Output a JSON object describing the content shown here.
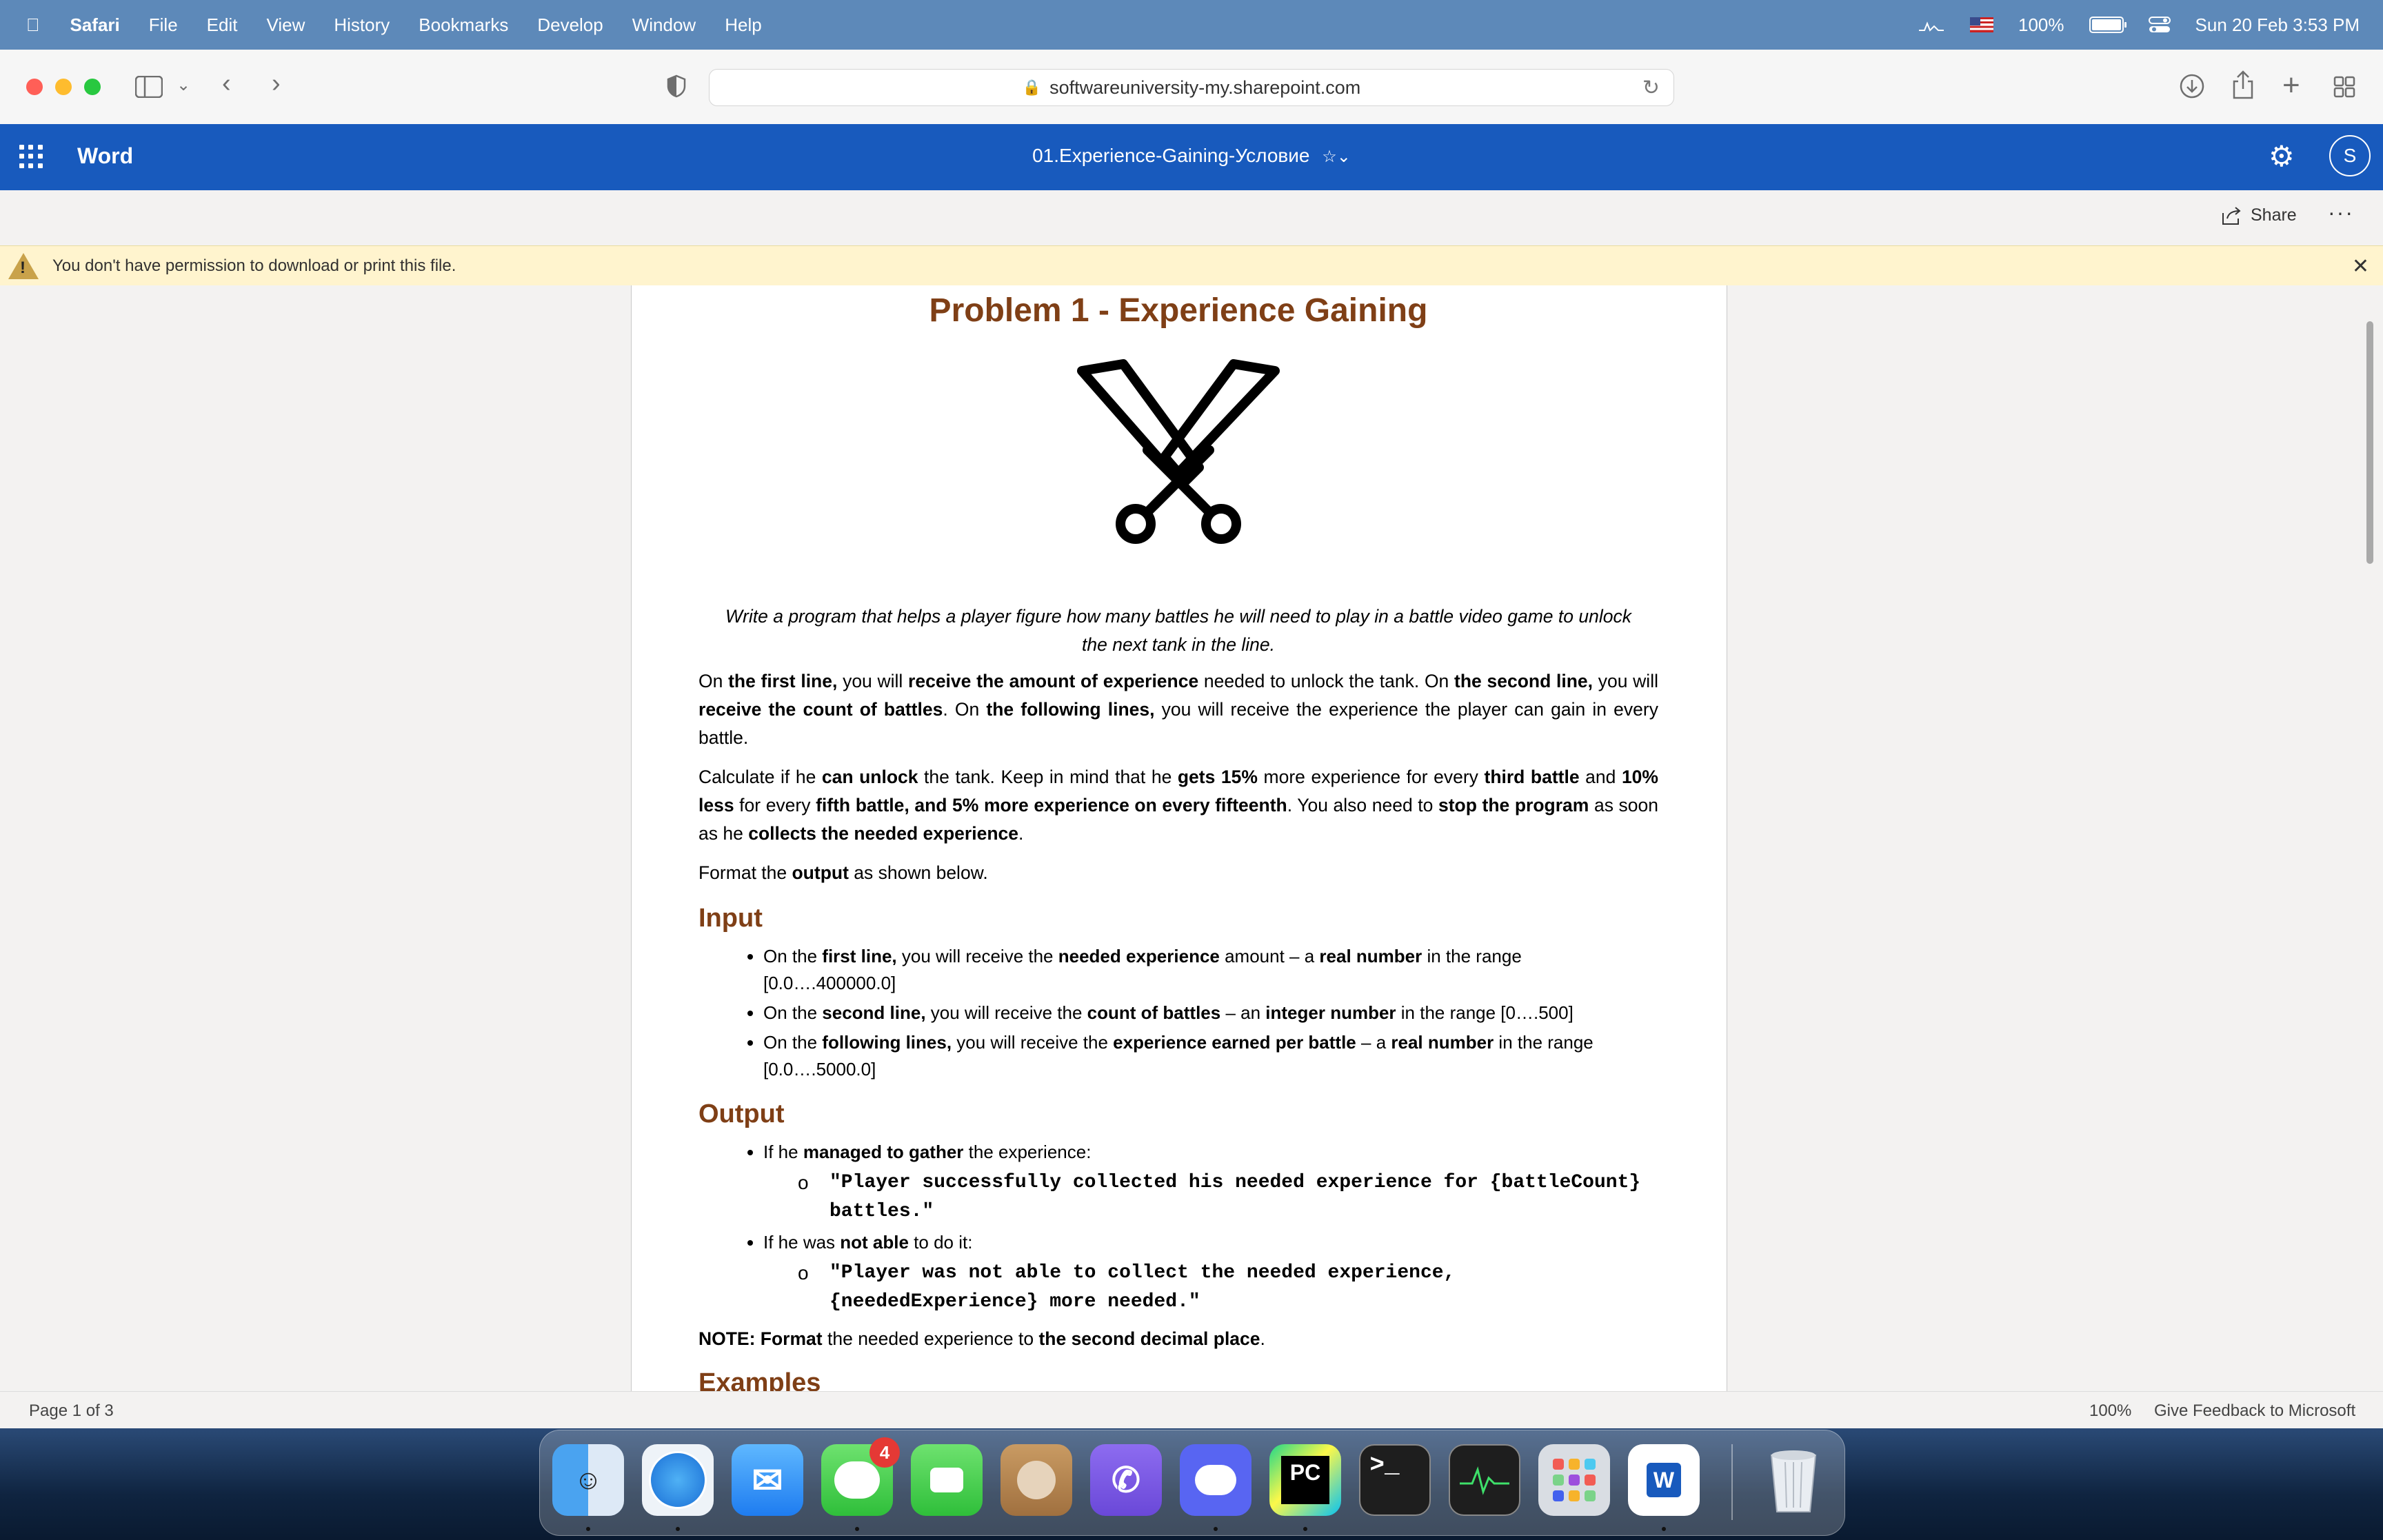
{
  "menubar": {
    "items": [
      "Safari",
      "File",
      "Edit",
      "View",
      "History",
      "Bookmarks",
      "Develop",
      "Window",
      "Help"
    ],
    "battery_label": "100%",
    "battery_level": 1.0,
    "datetime": "Sun 20 Feb  3:53 PM"
  },
  "browser": {
    "url": "softwareuniversity-my.sharepoint.com"
  },
  "word": {
    "app_name": "Word",
    "doc_title": "01.Experience-Gaining-Условие",
    "avatar_initial": "S",
    "share_label": "Share",
    "more_label": "···"
  },
  "notice": {
    "text": "You don't have permission to download or print this file."
  },
  "document": {
    "title": "Problem 1 - Experience Gaining",
    "lead": "Write a program that helps a player figure how many battles he will need to play in a battle video game to unlock the next tank in the line.",
    "p1": [
      {
        "t": "On ",
        "b": false
      },
      {
        "t": "the first line,",
        "b": true
      },
      {
        "t": " you will ",
        "b": false
      },
      {
        "t": "receive the amount of experience",
        "b": true
      },
      {
        "t": " needed to unlock the tank. On ",
        "b": false
      },
      {
        "t": "the second line,",
        "b": true
      },
      {
        "t": " you will ",
        "b": false
      },
      {
        "t": "receive the count of battles",
        "b": true
      },
      {
        "t": ". On ",
        "b": false
      },
      {
        "t": "the following lines,",
        "b": true
      },
      {
        "t": " you will receive the experience the player can gain in every battle.",
        "b": false
      }
    ],
    "p2": [
      {
        "t": "Calculate if he ",
        "b": false
      },
      {
        "t": "can unlock",
        "b": true
      },
      {
        "t": " the tank. Keep in mind that he ",
        "b": false
      },
      {
        "t": "gets 15%",
        "b": true
      },
      {
        "t": " more experience for every ",
        "b": false
      },
      {
        "t": "third battle",
        "b": true
      },
      {
        "t": " and ",
        "b": false
      },
      {
        "t": "10% less",
        "b": true
      },
      {
        "t": " for every ",
        "b": false
      },
      {
        "t": "fifth battle, and 5% more experience on every fifteenth",
        "b": true
      },
      {
        "t": ". You also need to ",
        "b": false
      },
      {
        "t": "stop the program",
        "b": true
      },
      {
        "t": " as soon as he ",
        "b": false
      },
      {
        "t": "collects the needed experience",
        "b": true
      },
      {
        "t": ".",
        "b": false
      }
    ],
    "p3": [
      {
        "t": "Format the ",
        "b": false
      },
      {
        "t": "output",
        "b": true
      },
      {
        "t": " as shown below.",
        "b": false
      }
    ],
    "input_heading": "Input",
    "input_items": [
      [
        {
          "t": "On the ",
          "b": false
        },
        {
          "t": "first line,",
          "b": true
        },
        {
          "t": " you will receive the ",
          "b": false
        },
        {
          "t": "needed experience",
          "b": true
        },
        {
          "t": " amount – a ",
          "b": false
        },
        {
          "t": "real number",
          "b": true
        },
        {
          "t": " in the range [0.0….400000.0]",
          "b": false
        }
      ],
      [
        {
          "t": "On the ",
          "b": false
        },
        {
          "t": "second line,",
          "b": true
        },
        {
          "t": " you will receive the ",
          "b": false
        },
        {
          "t": "count of battles",
          "b": true
        },
        {
          "t": " – an ",
          "b": false
        },
        {
          "t": "integer number",
          "b": true
        },
        {
          "t": " in the range [0….500]",
          "b": false
        }
      ],
      [
        {
          "t": "On the ",
          "b": false
        },
        {
          "t": "following lines,",
          "b": true
        },
        {
          "t": " you will receive the ",
          "b": false
        },
        {
          "t": "experience earned per battle",
          "b": true
        },
        {
          "t": " – a ",
          "b": false
        },
        {
          "t": "real number",
          "b": true
        },
        {
          "t": " in the range [0.0….5000.0]",
          "b": false
        }
      ]
    ],
    "output_heading": "Output",
    "output_items": [
      {
        "text": [
          {
            "t": "If he ",
            "b": false
          },
          {
            "t": "managed to gather",
            "b": true
          },
          {
            "t": " the experience:",
            "b": false
          }
        ],
        "code": "\"Player successfully collected his needed experience for {battleCount} battles.\""
      },
      {
        "text": [
          {
            "t": "If he was ",
            "b": false
          },
          {
            "t": "not able",
            "b": true
          },
          {
            "t": " to do it:",
            "b": false
          }
        ],
        "code": "\"Player was not able to collect the needed experience, {neededExperience} more needed.\""
      }
    ],
    "note": [
      {
        "t": "NOTE: Format",
        "b": true
      },
      {
        "t": " the needed experience to ",
        "b": false
      },
      {
        "t": "the second decimal place",
        "b": true
      },
      {
        "t": ".",
        "b": false
      }
    ],
    "examples_heading": "Examples"
  },
  "statusbar": {
    "page": "Page 1 of 3",
    "zoom": "100%",
    "feedback": "Give Feedback to Microsoft"
  },
  "dock": {
    "messages_badge": "4",
    "pycharm_label": "PC",
    "terminal_label": ">_",
    "word_label": "W"
  },
  "colors": {
    "word_blue": "#185abd",
    "heading_brown": "#7f3f16",
    "notice_yellow": "#fff4ce",
    "menubar_blue": "#5d89b9"
  }
}
